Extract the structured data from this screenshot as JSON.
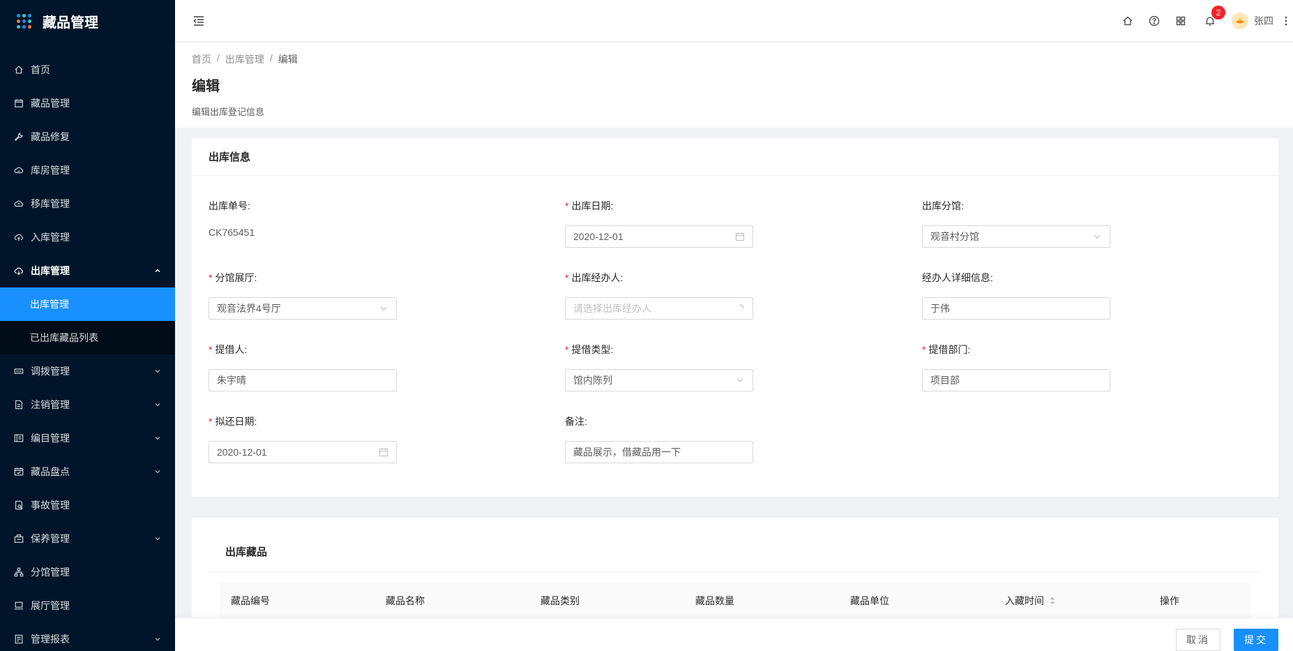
{
  "app": {
    "title": "藏品管理"
  },
  "sidebar": {
    "items": [
      {
        "label": "首页",
        "icon": "home-icon"
      },
      {
        "label": "藏品管理",
        "icon": "calendar-icon"
      },
      {
        "label": "藏品修复",
        "icon": "wrench-icon"
      },
      {
        "label": "库房管理",
        "icon": "cloud-icon"
      },
      {
        "label": "移库管理",
        "icon": "cloud-sync-icon"
      },
      {
        "label": "入库管理",
        "icon": "cloud-upload-icon"
      },
      {
        "label": "出库管理",
        "icon": "cloud-download-icon",
        "open": true,
        "children": [
          {
            "label": "出库管理",
            "active": true
          },
          {
            "label": "已出库藏品列表"
          }
        ]
      },
      {
        "label": "调拨管理",
        "icon": "swap-icon",
        "arrow": true
      },
      {
        "label": "注销管理",
        "icon": "file-icon",
        "arrow": true
      },
      {
        "label": "编目管理",
        "icon": "catalog-icon",
        "arrow": true
      },
      {
        "label": "藏品盘点",
        "icon": "inventory-icon",
        "arrow": true
      },
      {
        "label": "事故管理",
        "icon": "accident-icon"
      },
      {
        "label": "保养管理",
        "icon": "maintenance-icon",
        "arrow": true
      },
      {
        "label": "分馆管理",
        "icon": "branch-icon"
      },
      {
        "label": "展厅管理",
        "icon": "hall-icon"
      },
      {
        "label": "管理报表",
        "icon": "report-icon",
        "arrow": true
      }
    ]
  },
  "header": {
    "notifications_count": "2",
    "user_name": "张四"
  },
  "breadcrumb": {
    "items": [
      "首页",
      "出库管理",
      "编辑"
    ]
  },
  "page": {
    "title": "编辑",
    "description": "编辑出库登记信息"
  },
  "form": {
    "section_title": "出库信息",
    "order_no": {
      "label": "出库单号:",
      "value": "CK765451"
    },
    "out_date": {
      "label": "出库日期:",
      "value": "2020-12-01"
    },
    "branch": {
      "label": "出库分馆:",
      "value": "观音村分馆"
    },
    "hall": {
      "label": "分馆展厅:",
      "value": "观音法界4号厅"
    },
    "handler": {
      "label": "出库经办人:",
      "placeholder": "请选择出库经办人"
    },
    "handler_detail": {
      "label": "经办人详细信息:",
      "value": "于伟"
    },
    "borrower": {
      "label": "提借人:",
      "value": "朱宇晴"
    },
    "borrow_type": {
      "label": "提借类型:",
      "value": "馆内陈列"
    },
    "borrow_dept": {
      "label": "提借部门:",
      "value": "项目部"
    },
    "return_date": {
      "label": "拟还日期:",
      "value": "2020-12-01"
    },
    "remark": {
      "label": "备注:",
      "value": "藏品展示，借藏品用一下"
    }
  },
  "items_table": {
    "title": "出库藏品",
    "columns": [
      "藏品编号",
      "藏品名称",
      "藏品类别",
      "藏品数量",
      "藏品单位",
      "入藏时间",
      "操作"
    ]
  },
  "footer": {
    "cancel_label": "取消",
    "submit_label": "提交"
  }
}
